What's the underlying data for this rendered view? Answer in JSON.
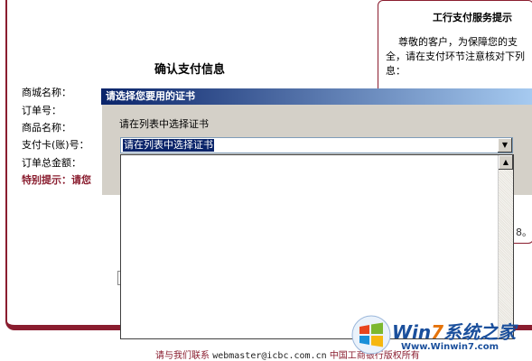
{
  "background_page": {
    "confirm_title": "确认支付信息",
    "fields": [
      {
        "label": "商城名称："
      },
      {
        "label": "订单号："
      },
      {
        "label": "商品名称："
      },
      {
        "label": "支付卡(账)号："
      },
      {
        "label": "订单总金额："
      }
    ],
    "special_tip": "特别提示：请您",
    "notice": {
      "title": "工行支付服务提示",
      "lines": [
        "尊敬的客户，为保障您的支",
        "全，请在支付环节注意核对下列",
        "息："
      ],
      "tail": "8。"
    },
    "footer": {
      "contact": "请与我们联系",
      "email": "webmaster@icbc.com.cn",
      "copyright": "中国工商银行版权所有"
    }
  },
  "dialog": {
    "title": "请选择您要用的证书",
    "prompt": "请在列表中选择证书",
    "select_value": "请在列表中选择证书",
    "list_items": []
  },
  "watermark": {
    "brand_prefix": "Win",
    "brand_seven": "7",
    "brand_suffix": "系统之家",
    "url": "Www.Winwin7.com"
  },
  "colors": {
    "accent": "#8a1d2f",
    "dialog_title_start": "#0a246a",
    "dialog_title_end": "#a6caf0",
    "dialog_bg": "#d4d0c8"
  }
}
